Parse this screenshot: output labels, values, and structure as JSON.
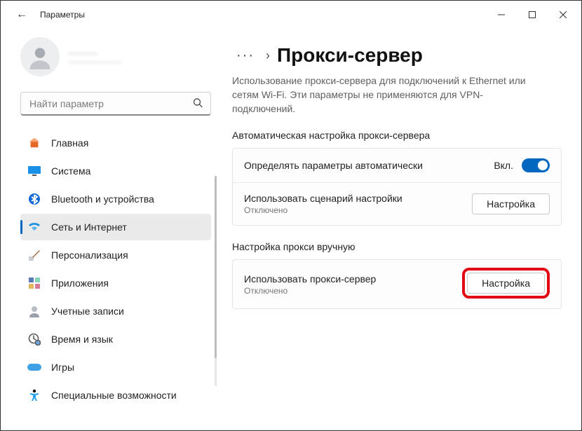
{
  "titlebar": {
    "app_name": "Параметры"
  },
  "user": {
    "display_name": "———",
    "email": "———————"
  },
  "search": {
    "placeholder": "Найти параметр"
  },
  "nav": [
    {
      "id": "home",
      "label": "Главная"
    },
    {
      "id": "system",
      "label": "Система"
    },
    {
      "id": "bluetooth",
      "label": "Bluetooth и устройства"
    },
    {
      "id": "network",
      "label": "Сеть и Интернет"
    },
    {
      "id": "personalize",
      "label": "Персонализация"
    },
    {
      "id": "apps",
      "label": "Приложения"
    },
    {
      "id": "accounts",
      "label": "Учетные записи"
    },
    {
      "id": "time",
      "label": "Время и язык"
    },
    {
      "id": "gaming",
      "label": "Игры"
    },
    {
      "id": "accessibility",
      "label": "Специальные возможности"
    }
  ],
  "nav_active_index": 3,
  "breadcrumb": {
    "sep": "›",
    "title": "Прокси-сервер"
  },
  "page": {
    "description": "Использование прокси-сервера для подключений к Ethernet или сетям Wi-Fi. Эти параметры не применяются для VPN-подключений."
  },
  "sections": {
    "auto": {
      "heading": "Автоматическая настройка прокси-сервера",
      "detect": {
        "label": "Определять параметры автоматически",
        "state_label": "Вкл.",
        "value": true
      },
      "script": {
        "label": "Использовать сценарий настройки",
        "sub": "Отключено",
        "button": "Настройка"
      }
    },
    "manual": {
      "heading": "Настройка прокси вручную",
      "use": {
        "label": "Использовать прокси-сервер",
        "sub": "Отключено",
        "button": "Настройка"
      }
    }
  }
}
